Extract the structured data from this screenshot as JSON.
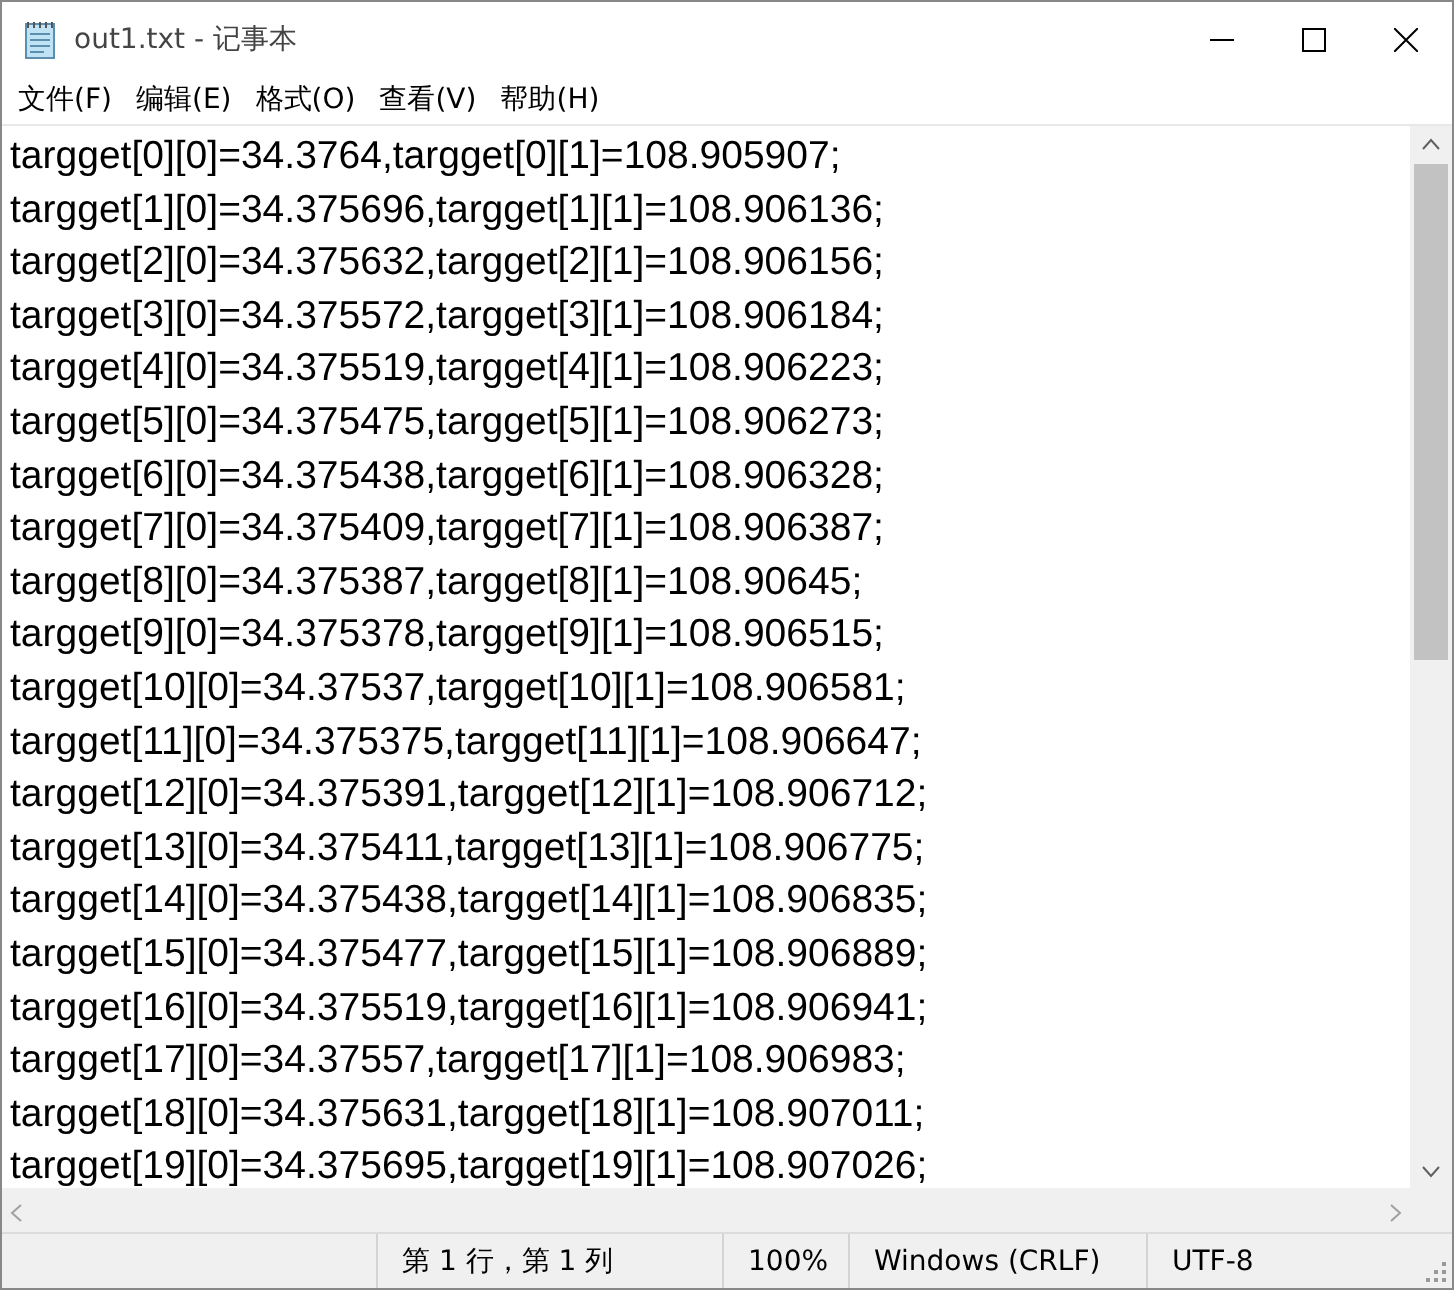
{
  "window": {
    "title": "out1.txt - 记事本"
  },
  "menu": [
    "文件(F)",
    "编辑(E)",
    "格式(O)",
    "查看(V)",
    "帮助(H)"
  ],
  "lines": [
    "targget[0][0]=34.3764,targget[0][1]=108.905907;",
    "targget[1][0]=34.375696,targget[1][1]=108.906136;",
    "targget[2][0]=34.375632,targget[2][1]=108.906156;",
    "targget[3][0]=34.375572,targget[3][1]=108.906184;",
    "targget[4][0]=34.375519,targget[4][1]=108.906223;",
    "targget[5][0]=34.375475,targget[5][1]=108.906273;",
    "targget[6][0]=34.375438,targget[6][1]=108.906328;",
    "targget[7][0]=34.375409,targget[7][1]=108.906387;",
    "targget[8][0]=34.375387,targget[8][1]=108.90645;",
    "targget[9][0]=34.375378,targget[9][1]=108.906515;",
    "targget[10][0]=34.37537,targget[10][1]=108.906581;",
    "targget[11][0]=34.375375,targget[11][1]=108.906647;",
    "targget[12][0]=34.375391,targget[12][1]=108.906712;",
    "targget[13][0]=34.375411,targget[13][1]=108.906775;",
    "targget[14][0]=34.375438,targget[14][1]=108.906835;",
    "targget[15][0]=34.375477,targget[15][1]=108.906889;",
    "targget[16][0]=34.375519,targget[16][1]=108.906941;",
    "targget[17][0]=34.37557,targget[17][1]=108.906983;",
    "targget[18][0]=34.375631,targget[18][1]=108.907011;",
    "targget[19][0]=34.375695,targget[19][1]=108.907026;"
  ],
  "status_bar": {
    "position": "第 1 行，第 1 列",
    "zoom": "100%",
    "line_ending": "Windows (CRLF)",
    "encoding": "UTF-8"
  }
}
